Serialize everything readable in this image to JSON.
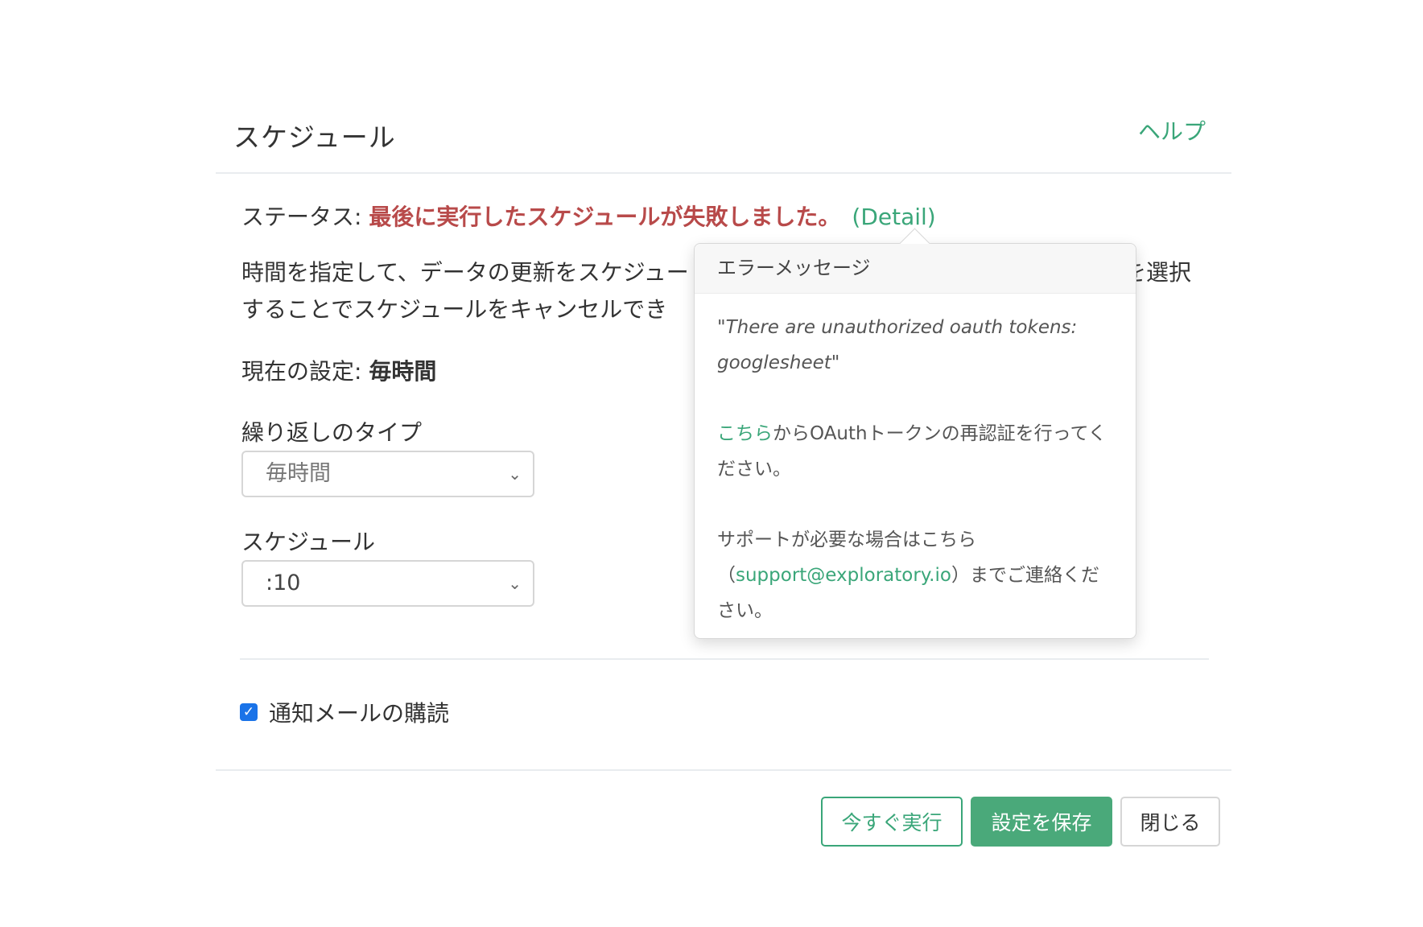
{
  "dialog": {
    "title": "スケジュール",
    "help_label": "ヘルプ"
  },
  "status": {
    "label": "ステータス: ",
    "message": "最後に実行したスケジュールが失敗しました。",
    "detail_label": "(Detail)"
  },
  "description": {
    "line1": "時間を指定して、データの更新をスケジュー",
    "line1_end": "を選択",
    "line2": "することでスケジュールをキャンセルでき"
  },
  "current_setting": {
    "label": "現在の設定: ",
    "value": "毎時間"
  },
  "repeat_type": {
    "label": "繰り返しのタイプ",
    "selected": "毎時間"
  },
  "schedule": {
    "label": "スケジュール",
    "selected": ":10"
  },
  "notify": {
    "label": "通知メールの購読",
    "checked": true
  },
  "buttons": {
    "run_now": "今すぐ実行",
    "save": "設定を保存",
    "close": "閉じる"
  },
  "popover": {
    "title": "エラーメッセージ",
    "error_text": "\"There are unauthorized oauth tokens: googlesheet\"",
    "reauth_link": "こちら",
    "reauth_text": "からOAuthトークンの再認証を行ってください。",
    "support_prefix": "サポートが必要な場合はこちら（",
    "support_email": "support@exploratory.io",
    "support_suffix": "）までご連絡ください。"
  },
  "colors": {
    "accent": "#3aa679",
    "error": "#b84a4a",
    "save_button": "#4aa97a",
    "checkbox": "#1a73e8"
  },
  "icons": {
    "select_chevron": "chevron-down-icon",
    "checkbox": "check-icon"
  }
}
